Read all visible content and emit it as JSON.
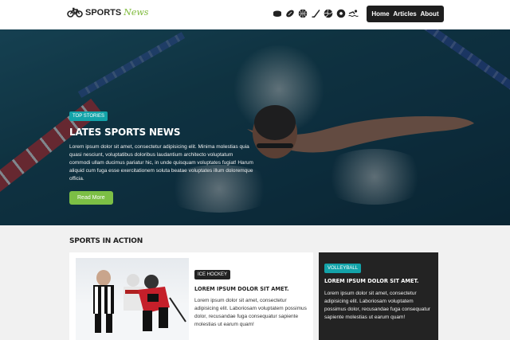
{
  "brand": {
    "name_bold": "SPORTS",
    "name_script": "News",
    "accent": "#7fba3c"
  },
  "header": {
    "sport_icons": [
      "hockey-puck-icon",
      "football-icon",
      "basketball-icon",
      "hockey-stick-icon",
      "volleyball-icon",
      "soccer-ball-icon",
      "swimming-icon"
    ],
    "nav": [
      "Home",
      "Articles",
      "About"
    ]
  },
  "hero": {
    "badge": "TOP STORIES",
    "title": "LATES SPORTS NEWS",
    "text": "Lorem ipsum dolor sit amet, consectetur adipisicing elit. Minima molestias quia quasi nesciunt, voluptatibus doloribus laudantium architecto voluptatum commodi ullam ducimus pariatur hic, in unde quisquam voluptates fugiat! Harum aliquid cum fuga esse exercitationem soluta beatae voluptates illum doloremque officia.",
    "button": "Read More"
  },
  "section": {
    "title": "SPORTS IN ACTION",
    "cards": [
      {
        "badge": "ICE HOCKEY",
        "title": "LOREM IPSUM DOLOR SIT AMET.",
        "text": "Lorem ipsum dolor sit amet, consectetur adipisicing elit. Laboriosam voluptatem possimus dolor, recusandae fuga consequatur sapiente molestias ut earum quam!"
      },
      {
        "badge": "VOLLEYBALL",
        "title": "LOREM IPSUM DOLOR SIT AMET.",
        "text": "Lorem ipsum dolor sit amet, consectetur adipisicing elit. Laboriosam voluptatem possimus dolor, recusandae fuga consequatur sapiente molestias ut earum quam!"
      }
    ]
  },
  "colors": {
    "teal": "#13a3a9",
    "dark": "#1e1e1e",
    "green_button": "#7cbf45"
  }
}
